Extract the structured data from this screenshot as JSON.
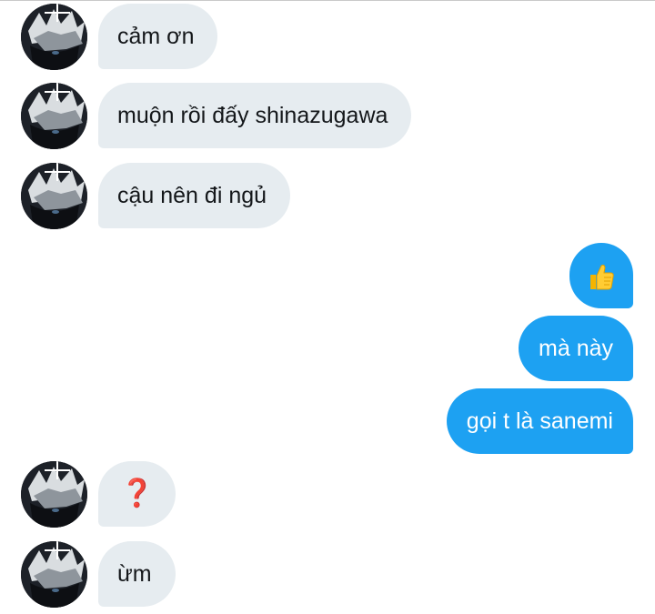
{
  "conversation": {
    "messages": [
      {
        "side": "in",
        "text": "cảm ơn"
      },
      {
        "side": "in",
        "text": "muộn rồi đấy shinazugawa"
      },
      {
        "side": "in",
        "text": "cậu nên đi ngủ"
      },
      {
        "side": "out",
        "text": "👍",
        "icon": "thumbs-up-emoji"
      },
      {
        "side": "out",
        "text": "mà này"
      },
      {
        "side": "out",
        "text": "gọi t là sanemi"
      },
      {
        "side": "in",
        "text": "❓",
        "icon": "red-question-mark-emoji"
      },
      {
        "side": "in",
        "text": "ừm"
      }
    ]
  },
  "colors": {
    "incoming_bubble": "#e6ecf0",
    "outgoing_bubble": "#1da1f2",
    "incoming_text": "#14171a",
    "outgoing_text": "#ffffff"
  }
}
